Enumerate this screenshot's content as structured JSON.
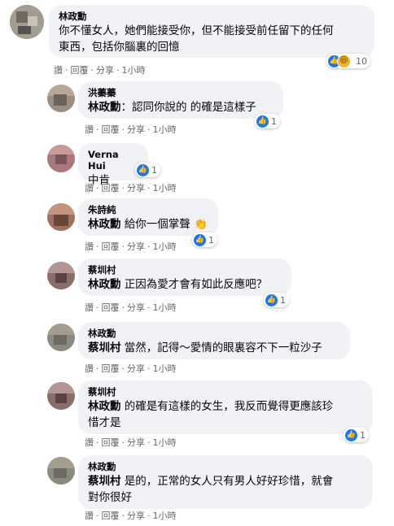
{
  "meta_actions": {
    "like": "讚",
    "reply": "回覆",
    "share": "分享"
  },
  "comments": [
    {
      "author": "林政勳",
      "mention": "",
      "text": "你不懂女人，她們能接受你，但不能接受前任留下的任何東西，包括你腦裏的回憶",
      "line1": "你不懂女人，她們能接受你，但不能接受前任留下的任何",
      "line2": "東西，包括你腦裏的回憶",
      "time": "1小時",
      "reactions": [
        "like",
        "haha"
      ],
      "reaction_count": "10"
    },
    {
      "author": "洪蓁蓁",
      "mention": "林政勳",
      "text": "：認同你說的 的確是這樣子",
      "time": "1小時",
      "reactions": [
        "like"
      ],
      "reaction_count": "1"
    },
    {
      "author": "Verna Hui",
      "mention": "",
      "text": "中肯",
      "time": "1小時",
      "reactions": [
        "like"
      ],
      "reaction_count": "1"
    },
    {
      "author": "朱詩純",
      "mention": "林政勳",
      "text": " 給你一個掌聲",
      "time": "1小時",
      "reactions": [
        "clap"
      ],
      "reaction_count": "1"
    },
    {
      "author": "蔡圳村",
      "mention": "林政勳",
      "text": " 正因為愛才會有如此反應吧？",
      "time": "1小時",
      "reactions": [
        "like"
      ],
      "reaction_count": "1"
    },
    {
      "author": "林政勳",
      "mention": "蔡圳村",
      "text": " 當然，記得～愛情的眼裏容不下一粒沙子",
      "time": "1小時",
      "reactions": [],
      "reaction_count": ""
    },
    {
      "author": "蔡圳村",
      "mention": "林政勳",
      "line1": " 的確是有這樣的女生，我反而覺得更應該珍",
      "line2": "惜才是",
      "time": "1小時",
      "reactions": [
        "like"
      ],
      "reaction_count": "1"
    },
    {
      "author": "林政勳",
      "mention": "蔡圳村",
      "line1": " 是的，正常的女人只有男人好好珍惜，就會",
      "line2": "對你很好",
      "time": "1小時",
      "reactions": [],
      "reaction_count": ""
    }
  ],
  "colors": {
    "bubble": "#f0f2f5",
    "meta": "#65676b",
    "like": "#1877f2"
  }
}
